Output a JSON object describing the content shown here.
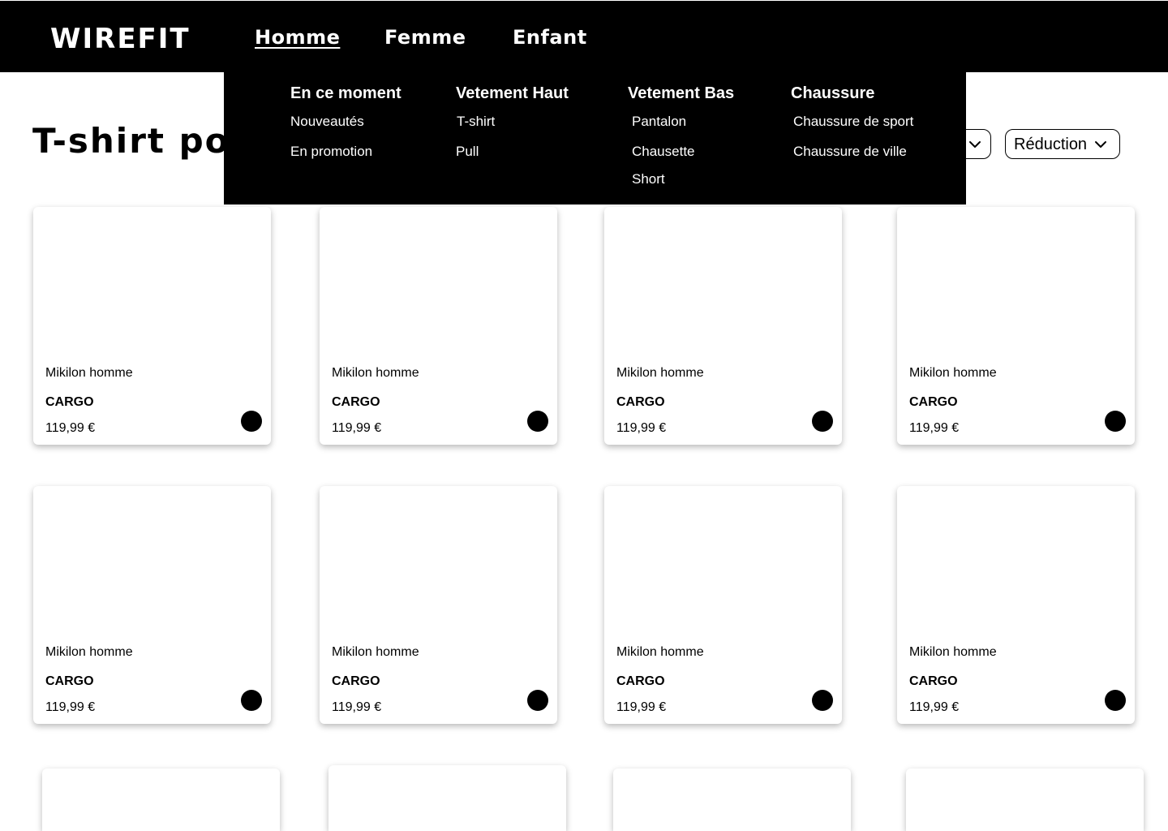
{
  "header": {
    "logo": "WIREFIT",
    "nav": [
      "Homme",
      "Femme",
      "Enfant"
    ]
  },
  "page_title": "T-shirt pou",
  "filters": {
    "reduction_label": "Réduction"
  },
  "mega_menu": {
    "columns": [
      {
        "heading": "En ce moment",
        "items": [
          "Nouveautés",
          "En promotion"
        ]
      },
      {
        "heading": "Vetement Haut",
        "items": [
          "T-shirt",
          "Pull"
        ]
      },
      {
        "heading": "Vetement Bas",
        "items": [
          "Pantalon",
          "Chausette",
          "Short"
        ]
      },
      {
        "heading": "Chaussure",
        "items": [
          "Chaussure de sport",
          "Chaussure de ville"
        ]
      }
    ]
  },
  "products": [
    {
      "name": "Mikilon homme",
      "model": "CARGO",
      "price": "119,99 €"
    },
    {
      "name": "Mikilon homme",
      "model": "CARGO",
      "price": "119,99 €"
    },
    {
      "name": "Mikilon homme",
      "model": "CARGO",
      "price": "119,99 €"
    },
    {
      "name": "Mikilon homme",
      "model": "CARGO",
      "price": "119,99 €"
    },
    {
      "name": "Mikilon homme",
      "model": "CARGO",
      "price": "119,99 €"
    },
    {
      "name": "Mikilon homme",
      "model": "CARGO",
      "price": "119,99 €"
    },
    {
      "name": "Mikilon homme",
      "model": "CARGO",
      "price": "119,99 €"
    },
    {
      "name": "Mikilon homme",
      "model": "CARGO",
      "price": "119,99 €"
    }
  ],
  "colors": {
    "header_bg": "#000000",
    "accent": "#000000",
    "page_bg": "#ffffff"
  },
  "icons": {
    "dropdown": "chevron-down-icon"
  }
}
